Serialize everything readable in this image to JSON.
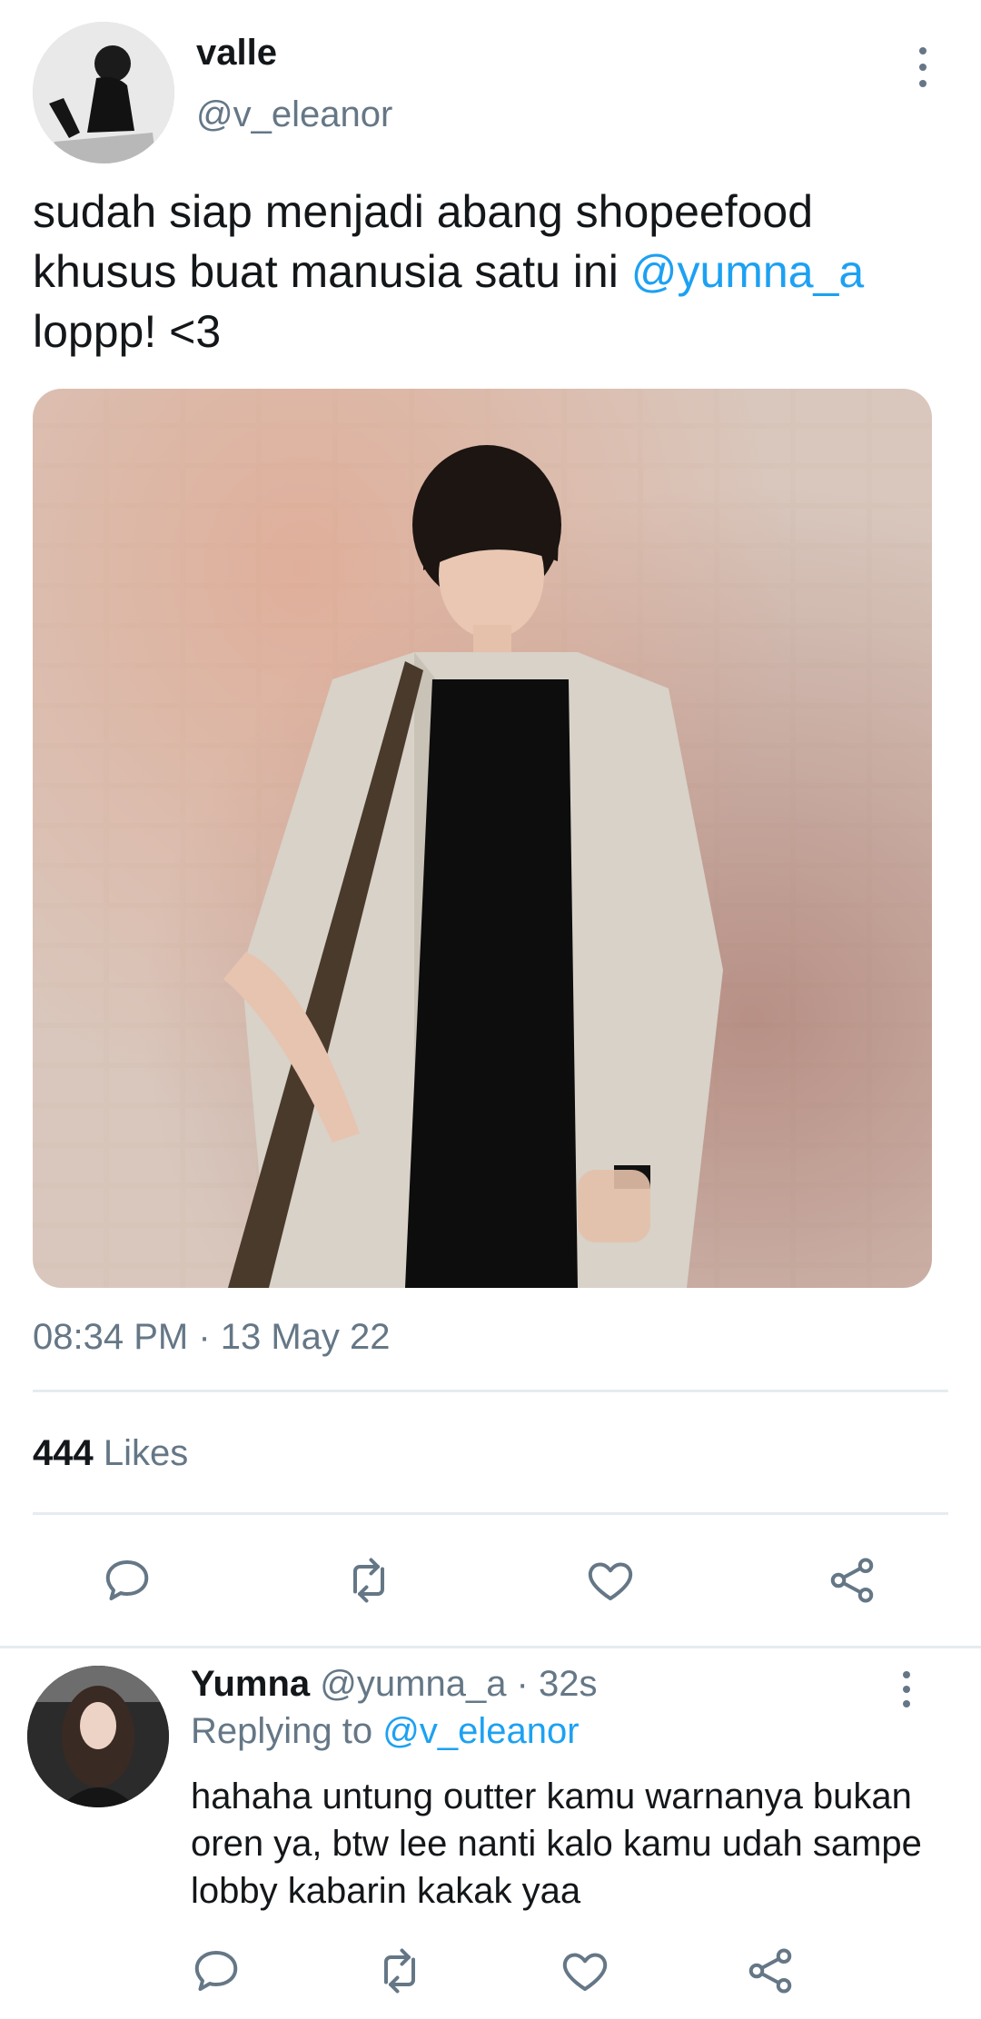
{
  "tweet": {
    "author": {
      "name": "valle",
      "handle": "@v_eleanor"
    },
    "text_before": "sudah siap menjadi abang shopeefood khusus buat manusia satu ini ",
    "mention": "@yumna_a",
    "text_after": " loppp! <3",
    "timestamp": "08:34 PM · 13 May 22",
    "likes_count": "444",
    "likes_label": "Likes"
  },
  "reply": {
    "name": "Yumna",
    "handle_time": "@yumna_a · 32s",
    "replying_to_label": "Replying to",
    "replying_to_handle": "@v_eleanor",
    "text": "hahaha untung outter kamu warnanya bukan oren ya, btw lee nanti kalo kamu udah sampe lobby kabarin kakak yaa"
  },
  "icons": [
    "more-icon",
    "reply-icon",
    "retweet-icon",
    "like-icon",
    "share-icon"
  ],
  "colors": {
    "accent": "#1da1f2",
    "secondary_text": "#657786",
    "primary_text": "#14171a",
    "divider": "#e6ecf0"
  }
}
